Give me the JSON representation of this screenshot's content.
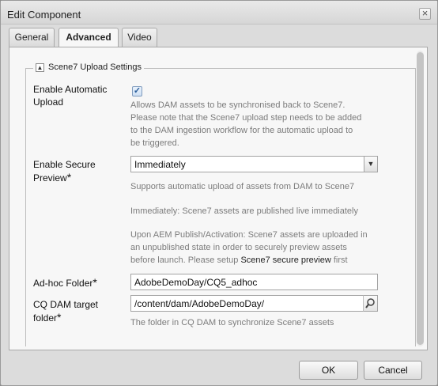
{
  "window": {
    "title": "Edit Component",
    "close_glyph": "×"
  },
  "tabs": [
    {
      "label": "General",
      "active": false
    },
    {
      "label": "Advanced",
      "active": true
    },
    {
      "label": "Video",
      "active": false
    }
  ],
  "section": {
    "collapse_glyph": "▲",
    "title": "Scene7 Upload Settings"
  },
  "fields": {
    "auto_upload": {
      "label_line1": "Enable Automatic",
      "label_line2": "Upload",
      "checked": true,
      "check_glyph": "✓",
      "help": [
        "Allows DAM assets to be synchronised back to Scene7.",
        "Please note that the Scene7 upload step needs to be added",
        "to the DAM ingestion workflow for the automatic upload to",
        "be triggered."
      ]
    },
    "secure_preview": {
      "label_line1": "Enable Secure",
      "label_line2": "Preview",
      "required_mark": "*",
      "selected": "Immediately",
      "dropdown_glyph": "▼",
      "help_1": "Supports automatic upload of assets from DAM to Scene7",
      "help_2": "Immediately: Scene7 assets are published live immediately",
      "help_3": [
        "Upon AEM Publish/Activation: Scene7 assets are uploaded in",
        "an unpublished state in order to securely preview assets"
      ],
      "help_3_last_prefix": "before launch. Please setup ",
      "help_3_link": "Scene7 secure preview",
      "help_3_last_suffix": " first"
    },
    "adhoc_folder": {
      "label": "Ad-hoc Folder",
      "required_mark": "*",
      "value": "AdobeDemoDay/CQ5_adhoc"
    },
    "dam_target": {
      "label_line1": "CQ DAM target",
      "label_line2": "folder",
      "required_mark": "*",
      "value": "/content/dam/AdobeDemoDay/",
      "help": "The folder in CQ DAM to synchronize Scene7 assets"
    }
  },
  "buttons": {
    "ok": "OK",
    "cancel": "Cancel"
  }
}
